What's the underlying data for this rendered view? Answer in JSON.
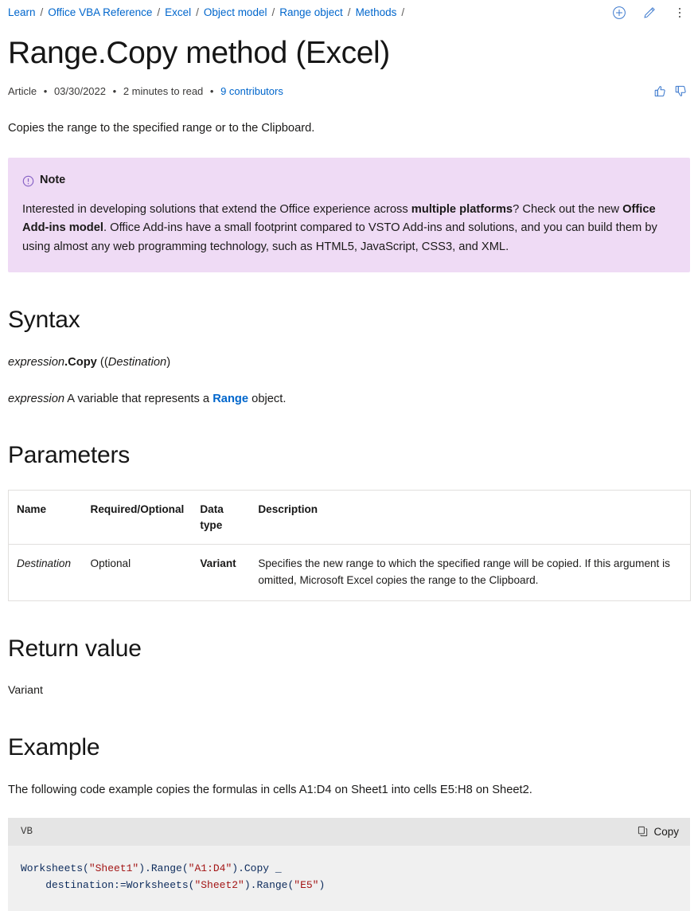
{
  "breadcrumb": {
    "items": [
      "Learn",
      "Office VBA Reference",
      "Excel",
      "Object model",
      "Range object",
      "Methods"
    ],
    "separator": "/"
  },
  "header_actions": [
    {
      "name": "add-to-collection-icon",
      "label": "Add"
    },
    {
      "name": "edit-icon",
      "label": "Edit"
    },
    {
      "name": "more-options-icon",
      "label": "More options"
    }
  ],
  "page": {
    "title": "Range.Copy method (Excel)"
  },
  "meta": {
    "type": "Article",
    "date": "03/30/2022",
    "read_time": "2 minutes to read",
    "contributors": "9 contributors",
    "separator": "•"
  },
  "feedback": {
    "like": "thumbs-up",
    "dislike": "thumbs-down"
  },
  "intro": "Copies the range to the specified range or to the Clipboard.",
  "note": {
    "icon": "info-circle-icon",
    "label": "Note",
    "text_part1": "Interested in developing solutions that extend the Office experience across ",
    "bold1": "multiple platforms",
    "text_part2": "? Check out the new ",
    "bold2": "Office Add-ins model",
    "text_part3": ". Office Add-ins have a small footprint compared to VSTO Add-ins and solutions, and you can build them by using almost any web programming technology, such as HTML5, JavaScript, CSS3, and XML.",
    "background": "#efdbf5"
  },
  "syntax": {
    "heading": "Syntax",
    "expression": "expression",
    "method": ".Copy",
    "open_paren": " (",
    "param": "Destination",
    "close_paren": ")",
    "desc_prefix": "expression",
    "desc_middle": " A variable that represents a ",
    "desc_link": "Range",
    "desc_suffix": " object."
  },
  "parameters": {
    "heading": "Parameters",
    "columns": [
      "Name",
      "Required/Optional",
      "Data type",
      "Description"
    ],
    "rows": [
      {
        "name": "Destination",
        "required": "Optional",
        "type": "Variant",
        "description": "Specifies the new range to which the specified range will be copied. If this argument is omitted, Microsoft Excel copies the range to the Clipboard."
      }
    ]
  },
  "return_value": {
    "heading": "Return value",
    "value": "Variant"
  },
  "example": {
    "heading": "Example",
    "description": "The following code example copies the formulas in cells A1:D4 on Sheet1 into cells E5:H8 on Sheet2.",
    "code_language": "VB",
    "copy_label": "Copy",
    "copy_icon": "copy-icon",
    "code_line1_a": "Worksheets(",
    "code_line1_s1": "\"Sheet1\"",
    "code_line1_b": ").Range(",
    "code_line1_s2": "\"A1:D4\"",
    "code_line1_c": ").Copy _",
    "code_line2_a": "    destination:=Worksheets(",
    "code_line2_s1": "\"Sheet2\"",
    "code_line2_b": ").Range(",
    "code_line2_s2": "\"E5\"",
    "code_line2_c": ")"
  },
  "colors": {
    "link": "#0066cc",
    "note_bg": "#efdbf5",
    "code_bg": "#f0f0f0",
    "code_header_bg": "#e5e5e5",
    "string_literal": "#a31515"
  }
}
